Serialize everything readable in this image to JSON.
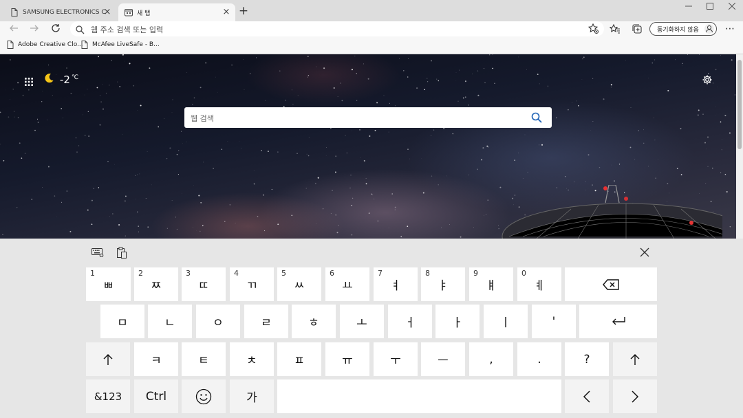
{
  "browser": {
    "tabs": [
      {
        "title": "SAMSUNG ELECTRONICS CO., LTD.",
        "active": false
      },
      {
        "title": "새 탭",
        "active": true
      }
    ],
    "address_placeholder": "웹 주소 검색 또는 입력",
    "sync_label": "동기화하지 않음",
    "bookmarks": [
      "Adobe Creative Clo...",
      "McAfee LiveSafe - B..."
    ]
  },
  "newtab": {
    "temperature": "-2",
    "temperature_unit": "℃",
    "search_placeholder": "웹 검색"
  },
  "keyboard": {
    "row1": [
      {
        "num": "1",
        "label": "ㅃ"
      },
      {
        "num": "2",
        "label": "ㅉ"
      },
      {
        "num": "3",
        "label": "ㄸ"
      },
      {
        "num": "4",
        "label": "ㄲ"
      },
      {
        "num": "5",
        "label": "ㅆ"
      },
      {
        "num": "6",
        "label": "ㅛ"
      },
      {
        "num": "7",
        "label": "ㅕ"
      },
      {
        "num": "8",
        "label": "ㅑ"
      },
      {
        "num": "9",
        "label": "ㅒ"
      },
      {
        "num": "0",
        "label": "ㅖ"
      }
    ],
    "row2": [
      "ㅁ",
      "ㄴ",
      "ㅇ",
      "ㄹ",
      "ㅎ",
      "ㅗ",
      "ㅓ",
      "ㅏ",
      "ㅣ",
      "'"
    ],
    "row3": [
      "ㅋ",
      "ㅌ",
      "ㅊ",
      "ㅍ",
      "ㅠ",
      "ㅜ",
      "ㅡ",
      ",",
      ".",
      "?"
    ],
    "symbols_label": "&123",
    "ctrl_label": "Ctrl",
    "lang_label": "가"
  },
  "icons": {
    "page": "page-icon",
    "newtab": "newtab-icon",
    "search": "search-icon",
    "favorites": "favorites-icon",
    "collections": "collections-icon",
    "settings": "gear-icon",
    "moon": "moon-icon"
  },
  "colors": {
    "search_accent": "#1a5fb4",
    "keyboard_bg": "#e6e6e6",
    "key_bg": "#ffffff"
  }
}
